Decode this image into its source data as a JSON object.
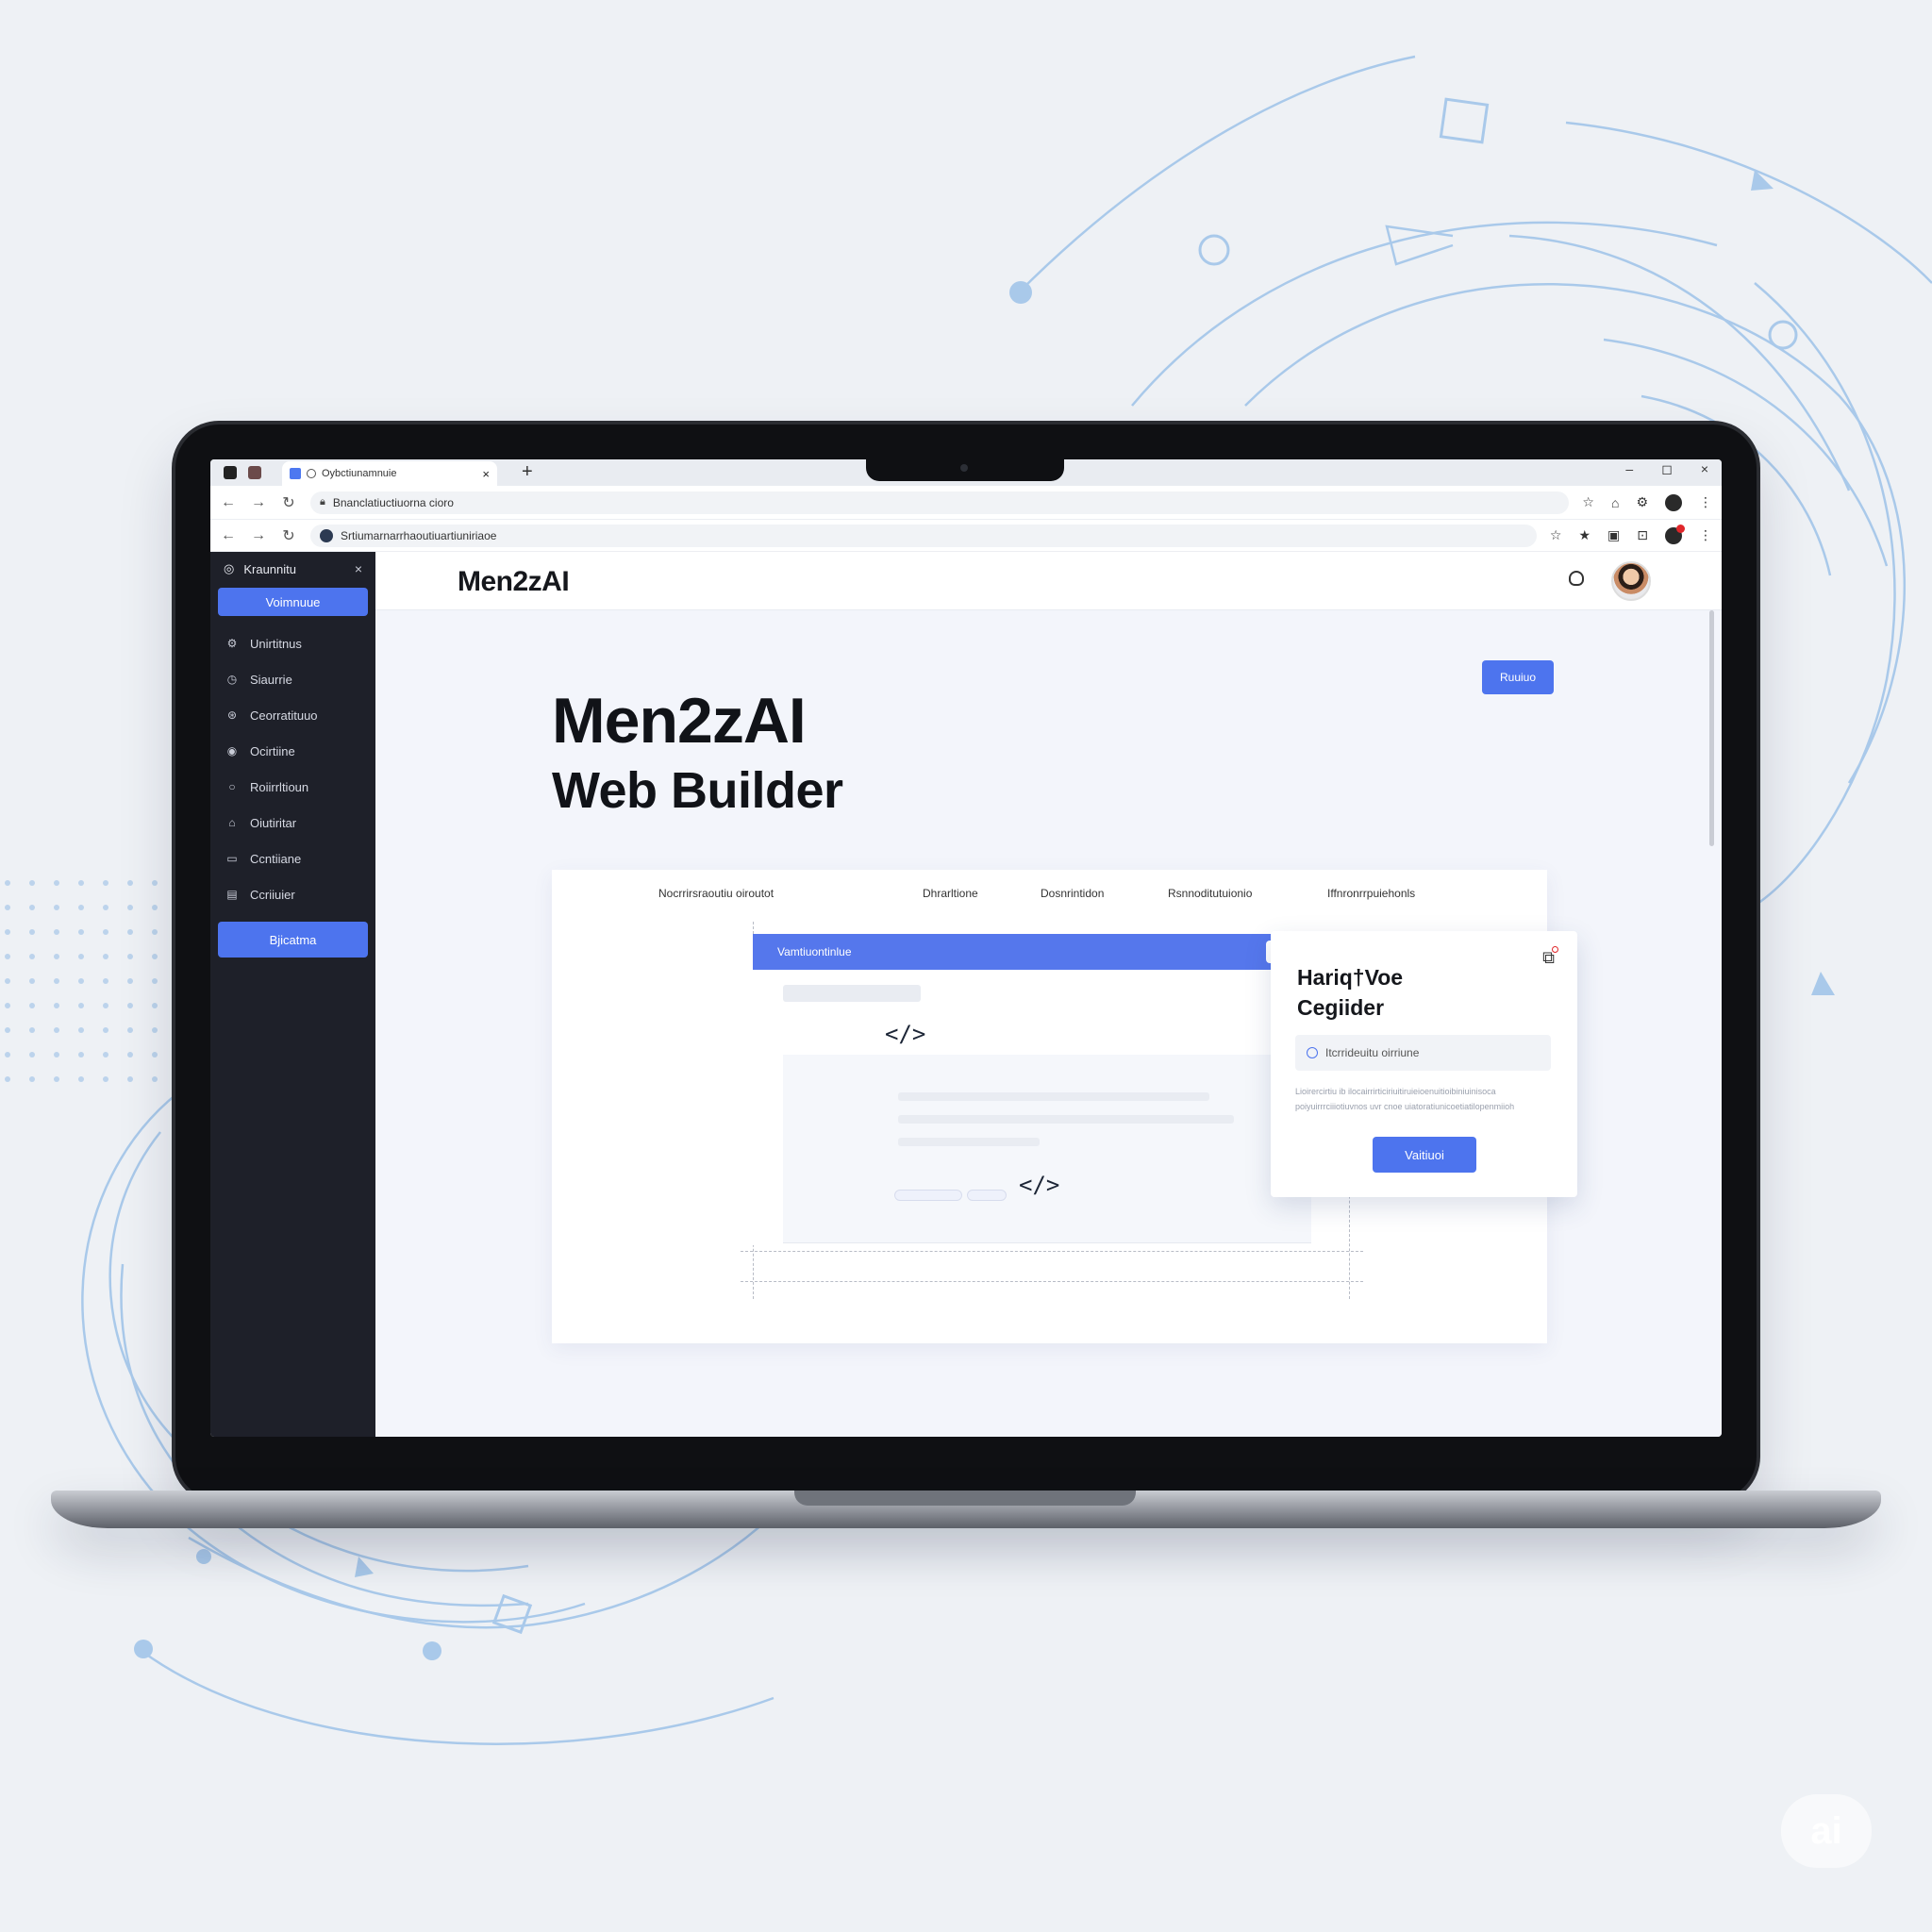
{
  "browser": {
    "tab_title": "Oybctiunamnuie",
    "close_tab": "×",
    "new_tab": "+",
    "window_controls": [
      "–",
      "◻",
      "×"
    ],
    "url_1": "Bnanclatiuctiuorna cioro",
    "url_2": "Srtiumarnarrhaoutiuartiuniriaoe"
  },
  "sidebar": {
    "header": "Kraunnitu",
    "close": "×",
    "primary_button": "Voimnuue",
    "items": [
      {
        "label": "Unirtitnus",
        "icon": "gear-icon"
      },
      {
        "label": "Siaurrie",
        "icon": "clock-icon"
      },
      {
        "label": "Ceorratituuo",
        "icon": "settings-icon"
      },
      {
        "label": "Ocirtiine",
        "icon": "chat-icon"
      },
      {
        "label": "Roiirrltioun",
        "icon": "circle-icon"
      },
      {
        "label": "Oiutiritar",
        "icon": "home-icon"
      },
      {
        "label": "Ccntiiane",
        "icon": "message-icon"
      },
      {
        "label": "Ccriiuier",
        "icon": "calendar-icon"
      }
    ],
    "bottom_button": "Bjicatma"
  },
  "header": {
    "brand": "Men2zAI"
  },
  "hero": {
    "line1": "Men2zAI",
    "line2": "Web Builder",
    "cta": "Ruuiuo"
  },
  "card": {
    "tabs": [
      "Nocrrirsraoutiu oiroutot",
      "Dhrarltione",
      "Dosnrintidon",
      "Rsnnoditutuionio",
      "Iffnronrrpuiehonls"
    ],
    "editor_title": "Vamtiuontinlue",
    "code_tag": "</>"
  },
  "popup": {
    "title": "Hariq†Voe\nCegiider",
    "input_placeholder": "Itcrrideuitu oirriune",
    "description": "Lioirercirtiu ib ilocairrirticiriuitiruieioenuitioibiniuinisoca poiyuirrrciiiotiuvnos uvr cnoe uiatoratiunicoetiatilopenmiioh",
    "button": "Vaitiuoi"
  },
  "watermark": "ai",
  "colors": {
    "accent": "#4d74ee",
    "sidebar_bg": "#1e2029",
    "background": "#eef1f5"
  }
}
